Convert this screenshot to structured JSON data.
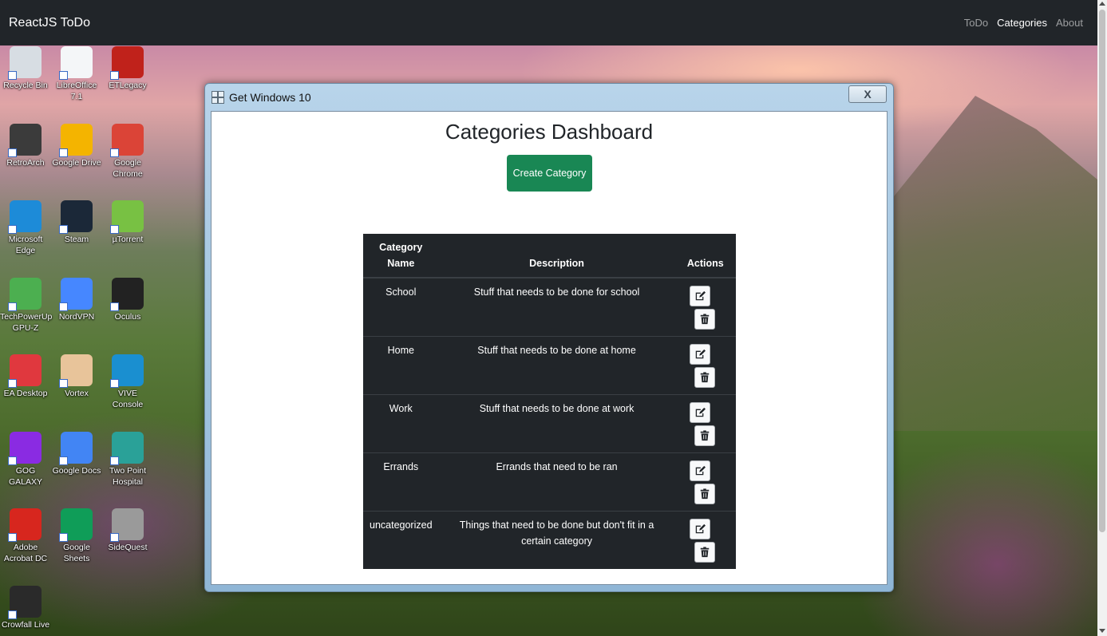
{
  "navbar": {
    "brand": "ReactJS ToDo",
    "links": [
      {
        "label": "ToDo",
        "active": false
      },
      {
        "label": "Categories",
        "active": true
      },
      {
        "label": "About",
        "active": false
      }
    ]
  },
  "desktop": {
    "icons": [
      {
        "label": "Recycle Bin",
        "color": "#d7dde3"
      },
      {
        "label": "LibreOffice 7.1",
        "color": "#f4f6f8"
      },
      {
        "label": "ETLegacy",
        "color": "#c0221b"
      },
      {
        "label": "RetroArch",
        "color": "#3b3b3b"
      },
      {
        "label": "Google Drive",
        "color": "#f4b400"
      },
      {
        "label": "Google Chrome",
        "color": "#db4437"
      },
      {
        "label": "Microsoft Edge",
        "color": "#1d8bd8"
      },
      {
        "label": "Steam",
        "color": "#1b2838"
      },
      {
        "label": "µTorrent",
        "color": "#78c143"
      },
      {
        "label": "TechPowerUp GPU-Z",
        "color": "#4caf50"
      },
      {
        "label": "NordVPN",
        "color": "#4687ff"
      },
      {
        "label": "Oculus",
        "color": "#222222"
      },
      {
        "label": "EA Desktop",
        "color": "#e0383e"
      },
      {
        "label": "Vortex",
        "color": "#e8c49a"
      },
      {
        "label": "VIVE Console",
        "color": "#1a8fd0"
      },
      {
        "label": "GOG GALAXY",
        "color": "#8a2be2"
      },
      {
        "label": "Google Docs",
        "color": "#4285f4"
      },
      {
        "label": "Two Point Hospital",
        "color": "#2aa198"
      },
      {
        "label": "Adobe Acrobat DC",
        "color": "#d7261e"
      },
      {
        "label": "Google Sheets",
        "color": "#0f9d58"
      },
      {
        "label": "SideQuest",
        "color": "#9a9a9a"
      },
      {
        "label": "Crowfall Live",
        "color": "#2a2a2a"
      }
    ]
  },
  "window": {
    "title": "Get Windows 10",
    "close_label": "X",
    "heading": "Categories Dashboard",
    "create_button": "Create Category",
    "table": {
      "headers": {
        "name": "Category Name",
        "description": "Description",
        "actions": "Actions"
      },
      "rows": [
        {
          "name": "School",
          "description": "Stuff that needs to be done for school"
        },
        {
          "name": "Home",
          "description": "Stuff that needs to be done at home"
        },
        {
          "name": "Work",
          "description": "Stuff that needs to be done at work"
        },
        {
          "name": "Errands",
          "description": "Errands that need to be ran"
        },
        {
          "name": "uncategorized",
          "description": "Things that need to be done but don't fit in a certain category"
        }
      ]
    }
  }
}
